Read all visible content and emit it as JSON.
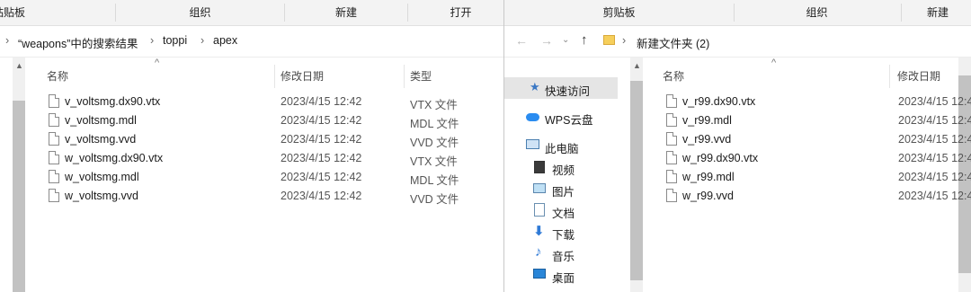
{
  "left": {
    "ribbon": {
      "clipboard": "粘贴板",
      "organize": "组织",
      "new": "新建",
      "open": "打开"
    },
    "breadcrumb": {
      "search": "“weapons”中的搜索结果",
      "p1": "toppi",
      "p2": "apex"
    },
    "columns": {
      "name": "名称",
      "date": "修改日期",
      "type": "类型"
    },
    "files": [
      {
        "name": "v_voltsmg.dx90.vtx",
        "date": "2023/4/15 12:42",
        "type": "VTX 文件"
      },
      {
        "name": "v_voltsmg.mdl",
        "date": "2023/4/15 12:42",
        "type": "MDL 文件"
      },
      {
        "name": "v_voltsmg.vvd",
        "date": "2023/4/15 12:42",
        "type": "VVD 文件"
      },
      {
        "name": "w_voltsmg.dx90.vtx",
        "date": "2023/4/15 12:42",
        "type": "VTX 文件"
      },
      {
        "name": "w_voltsmg.mdl",
        "date": "2023/4/15 12:42",
        "type": "MDL 文件"
      },
      {
        "name": "w_voltsmg.vvd",
        "date": "2023/4/15 12:42",
        "type": "VVD 文件"
      }
    ]
  },
  "right": {
    "ribbon": {
      "clipboard": "剪贴板",
      "organize": "组织",
      "new": "新建"
    },
    "address": "新建文件夹 (2)",
    "nav": [
      {
        "label": "快速访问",
        "icon": "star-icon"
      },
      {
        "label": "WPS云盘",
        "icon": "cloud-icon"
      },
      {
        "label": "此电脑",
        "icon": "pc-icon"
      },
      {
        "label": "视频",
        "icon": "video-icon"
      },
      {
        "label": "图片",
        "icon": "picture-icon"
      },
      {
        "label": "文档",
        "icon": "document-icon"
      },
      {
        "label": "下载",
        "icon": "download-icon"
      },
      {
        "label": "音乐",
        "icon": "music-icon"
      },
      {
        "label": "桌面",
        "icon": "desktop-icon"
      }
    ],
    "columns": {
      "name": "名称",
      "date": "修改日期"
    },
    "files": [
      {
        "name": "v_r99.dx90.vtx",
        "date": "2023/4/15 12:4"
      },
      {
        "name": "v_r99.mdl",
        "date": "2023/4/15 12:4"
      },
      {
        "name": "v_r99.vvd",
        "date": "2023/4/15 12:4"
      },
      {
        "name": "w_r99.dx90.vtx",
        "date": "2023/4/15 12:4"
      },
      {
        "name": "w_r99.mdl",
        "date": "2023/4/15 12:4"
      },
      {
        "name": "w_r99.vvd",
        "date": "2023/4/15 12:4"
      }
    ]
  }
}
